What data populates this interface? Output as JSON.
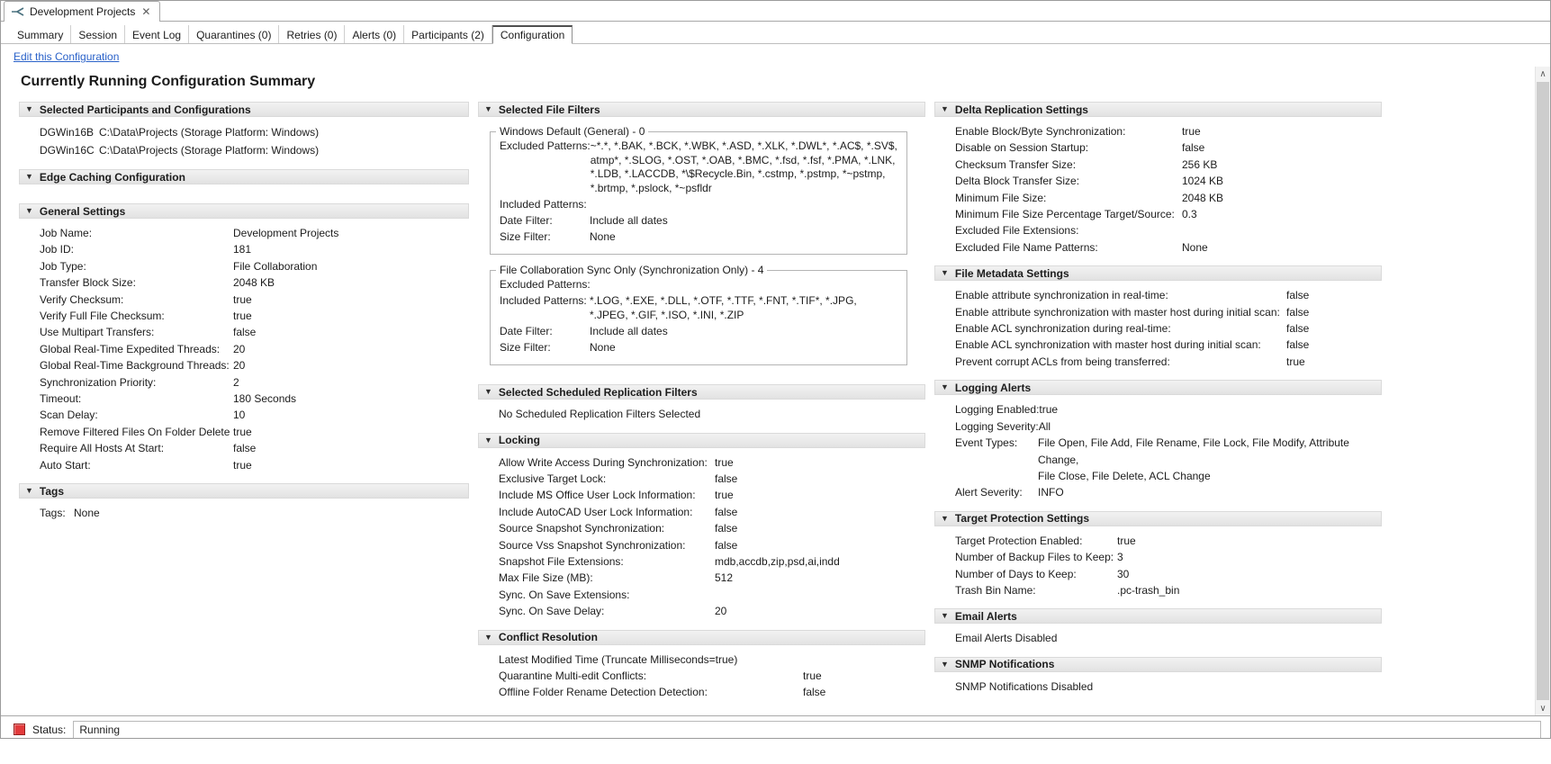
{
  "editor_tab": {
    "title": "Development Projects",
    "close": "✕"
  },
  "view_tabs": [
    "Summary",
    "Session",
    "Event Log",
    "Quarantines (0)",
    "Retries (0)",
    "Alerts (0)",
    "Participants (2)",
    "Configuration"
  ],
  "edit_link": "Edit this Configuration",
  "page_title": "Currently Running Configuration Summary",
  "col1": {
    "participants": {
      "title": "Selected Participants and Configurations",
      "rows": [
        {
          "host": "DGWin16B",
          "path": "C:\\Data\\Projects (Storage Platform: Windows)"
        },
        {
          "host": "DGWin16C",
          "path": "C:\\Data\\Projects (Storage Platform: Windows)"
        }
      ]
    },
    "edge_caching": {
      "title": "Edge Caching Configuration"
    },
    "general": {
      "title": "General Settings",
      "rows": [
        {
          "label": "Job Name:",
          "value": "Development Projects"
        },
        {
          "label": "Job ID:",
          "value": "181"
        },
        {
          "label": "Job Type:",
          "value": "File Collaboration"
        },
        {
          "label": "Transfer Block Size:",
          "value": "2048 KB"
        },
        {
          "label": "Verify Checksum:",
          "value": "true"
        },
        {
          "label": "Verify Full File Checksum:",
          "value": "true"
        },
        {
          "label": "Use Multipart Transfers:",
          "value": "false"
        },
        {
          "label": "Global Real-Time Expedited Threads:",
          "value": "20"
        },
        {
          "label": "Global Real-Time Background Threads:",
          "value": "20"
        },
        {
          "label": "Synchronization Priority:",
          "value": "2"
        },
        {
          "label": "Timeout:",
          "value": "180 Seconds"
        },
        {
          "label": "Scan Delay:",
          "value": "10"
        },
        {
          "label": "Remove Filtered Files On Folder Delete",
          "value": "true"
        },
        {
          "label": "Require All Hosts At Start:",
          "value": "false"
        },
        {
          "label": "Auto Start:",
          "value": "true"
        }
      ]
    },
    "tags": {
      "title": "Tags",
      "rows": [
        {
          "label": "Tags:",
          "value": "None"
        }
      ]
    }
  },
  "col2": {
    "file_filters": {
      "title": "Selected File Filters",
      "group1": {
        "title": "Windows Default (General) - 0",
        "rows": [
          {
            "label": "Excluded Patterns:",
            "value": "~*.*, *.BAK, *.BCK, *.WBK, *.ASD, *.XLK, *.DWL*, *.AC$, *.SV$, atmp*, *.SLOG, *.OST, *.OAB, *.BMC, *.fsd, *.fsf, *.PMA, *.LNK, *.LDB, *.LACCDB, *\\$Recycle.Bin, *.cstmp, *.pstmp, *~pstmp, *.brtmp, *.pslock, *~psfldr"
          },
          {
            "label": "Included Patterns:",
            "value": ""
          },
          {
            "label": "Date Filter:",
            "value": "Include all dates"
          },
          {
            "label": "Size Filter:",
            "value": "None"
          }
        ]
      },
      "group2": {
        "title": "File Collaboration Sync Only (Synchronization Only) - 4",
        "rows": [
          {
            "label": "Excluded Patterns:",
            "value": ""
          },
          {
            "label": "Included Patterns:",
            "value": "*.LOG, *.EXE, *.DLL, *.OTF, *.TTF, *.FNT, *.TIF*, *.JPG, *.JPEG, *.GIF, *.ISO, *.INI, *.ZIP"
          },
          {
            "label": "Date Filter:",
            "value": "Include all dates"
          },
          {
            "label": "Size Filter:",
            "value": "None"
          }
        ]
      }
    },
    "scheduled": {
      "title": "Selected Scheduled Replication Filters",
      "text": "No Scheduled Replication Filters Selected"
    },
    "locking": {
      "title": "Locking",
      "rows": [
        {
          "label": "Allow Write Access During Synchronization:",
          "value": "true"
        },
        {
          "label": "Exclusive Target Lock:",
          "value": "false"
        },
        {
          "label": "Include MS Office User Lock Information:",
          "value": "true"
        },
        {
          "label": "Include AutoCAD User Lock Information:",
          "value": "false"
        },
        {
          "label": "Source Snapshot Synchronization:",
          "value": "false"
        },
        {
          "label": "Source Vss Snapshot Synchronization:",
          "value": "false"
        },
        {
          "label": "Snapshot File Extensions:",
          "value": "mdb,accdb,zip,psd,ai,indd"
        },
        {
          "label": "Max File Size (MB):",
          "value": "512"
        },
        {
          "label": "Sync. On Save Extensions:",
          "value": ""
        },
        {
          "label": "Sync. On Save Delay:",
          "value": "20"
        }
      ]
    },
    "conflict": {
      "title": "Conflict Resolution",
      "line": "Latest Modified Time (Truncate Milliseconds=true)",
      "rows": [
        {
          "label": "Quarantine Multi-edit Conflicts:",
          "value": "true"
        },
        {
          "label": "Offline Folder Rename Detection Detection:",
          "value": "false"
        }
      ]
    }
  },
  "col3": {
    "delta": {
      "title": "Delta Replication Settings",
      "rows": [
        {
          "label": "Enable Block/Byte Synchronization:",
          "value": "true"
        },
        {
          "label": "Disable on Session Startup:",
          "value": "false"
        },
        {
          "label": "Checksum Transfer Size:",
          "value": "256 KB"
        },
        {
          "label": "Delta Block Transfer Size:",
          "value": "1024 KB"
        },
        {
          "label": "Minimum File Size:",
          "value": "2048 KB"
        },
        {
          "label": "Minimum File Size Percentage Target/Source:",
          "value": "0.3"
        },
        {
          "label": "Excluded File Extensions:",
          "value": ""
        },
        {
          "label": "Excluded File Name Patterns:",
          "value": "None"
        }
      ]
    },
    "metadata": {
      "title": "File Metadata Settings",
      "rows": [
        {
          "label": "Enable attribute synchronization in real-time:",
          "value": "false"
        },
        {
          "label": "Enable attribute synchronization with master host during initial scan:",
          "value": "false"
        },
        {
          "label": "Enable ACL synchronization during real-time:",
          "value": "false"
        },
        {
          "label": "Enable ACL synchronization with master host during initial scan:",
          "value": "false"
        },
        {
          "label": "Prevent corrupt ACLs from being transferred:",
          "value": "true"
        }
      ]
    },
    "logging": {
      "title": "Logging Alerts",
      "rows": [
        {
          "label": "Logging Enabled:",
          "value": "true"
        },
        {
          "label": "Logging Severity:",
          "value": "All"
        },
        {
          "label": "Event Types:",
          "value": "File Open, File Add, File Rename, File Lock, File Modify, Attribute Change,"
        },
        {
          "label": "",
          "value": "File Close, File Delete, ACL Change"
        },
        {
          "label": "Alert Severity:",
          "value": "INFO"
        }
      ]
    },
    "target": {
      "title": "Target Protection Settings",
      "rows": [
        {
          "label": "Target Protection Enabled:",
          "value": "true"
        },
        {
          "label": "Number of Backup Files to Keep:",
          "value": "3"
        },
        {
          "label": "Number of Days to Keep:",
          "value": "30"
        },
        {
          "label": "Trash Bin Name:",
          "value": ".pc-trash_bin"
        }
      ]
    },
    "email": {
      "title": "Email Alerts",
      "text": "Email Alerts Disabled"
    },
    "snmp": {
      "title": "SNMP Notifications",
      "text": "SNMP Notifications Disabled"
    }
  },
  "status": {
    "label": "Status:",
    "value": "Running"
  }
}
